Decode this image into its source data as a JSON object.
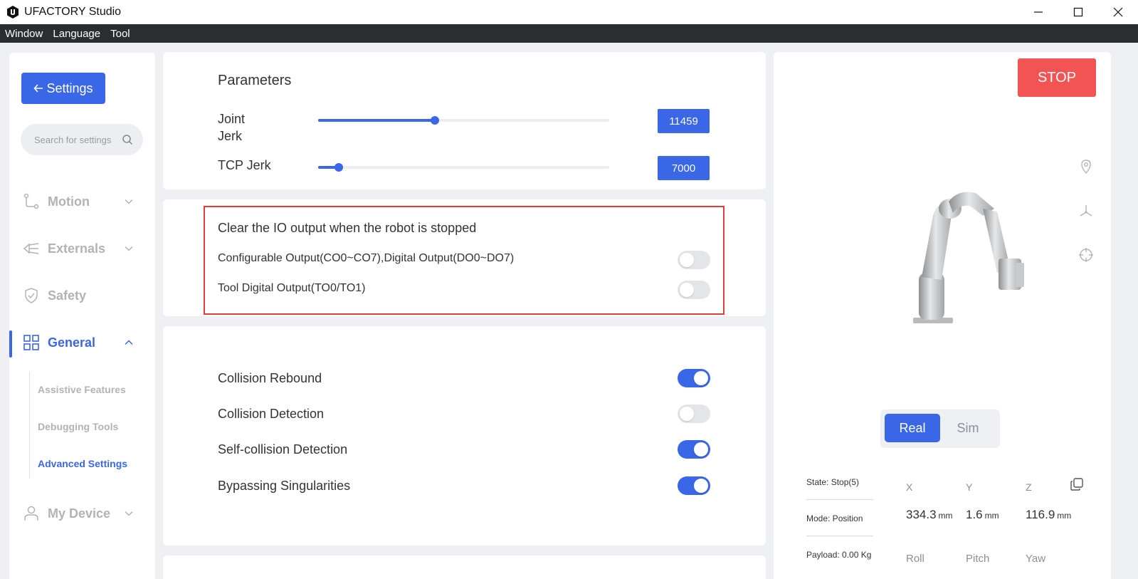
{
  "window": {
    "title": "UFACTORY Studio",
    "minimize_icon": "minimize-icon",
    "maximize_icon": "maximize-icon",
    "close_icon": "close-icon"
  },
  "menu": [
    "Window",
    "Language",
    "Tool"
  ],
  "sidebar": {
    "back_label": "Settings",
    "search_placeholder": "Search for settings",
    "items": [
      {
        "label": "Motion",
        "icon": "motion-icon",
        "expanded": false
      },
      {
        "label": "Externals",
        "icon": "externals-icon",
        "expanded": false
      },
      {
        "label": "Safety",
        "icon": "shield-icon"
      },
      {
        "label": "General",
        "icon": "grid-icon",
        "expanded": true,
        "active": true
      },
      {
        "label": "My Device",
        "icon": "user-icon",
        "expanded": false
      }
    ],
    "subitems": [
      "Assistive Features",
      "Debugging Tools",
      "Advanced Settings"
    ],
    "active_subitem": "Advanced Settings"
  },
  "parameters": {
    "title": "Parameters",
    "joint_jerk_line1": "Joint",
    "joint_jerk_line2": "Jerk",
    "joint_jerk_value": "11459",
    "joint_jerk_fraction": 0.4,
    "tcp_jerk_label": "TCP Jerk",
    "tcp_jerk_value": "7000",
    "tcp_jerk_fraction": 0.07
  },
  "io": {
    "title": "Clear the IO output when the robot is stopped",
    "configurable_label": "Configurable Output(CO0~CO7),Digital Output(DO0~DO7)",
    "configurable_on": false,
    "tool_label": "Tool Digital Output(TO0/TO1)",
    "tool_on": false
  },
  "features": {
    "collision_rebound": "Collision Rebound",
    "collision_rebound_on": true,
    "collision_detection": "Collision Detection",
    "collision_detection_on": false,
    "self_collision": "Self-collision Detection",
    "self_collision_on": true,
    "bypass_singularities": "Bypassing Singularities",
    "bypass_singularities_on": true
  },
  "right": {
    "stop_label": "STOP",
    "mode_real": "Real",
    "mode_sim": "Sim",
    "state": "State:  Stop(5)",
    "mode": "Mode:  Position",
    "payload": "Payload:  0.00 Kg",
    "x_label": "X",
    "y_label": "Y",
    "z_label": "Z",
    "x_value": "334.3",
    "y_value": "1.6",
    "z_value": "116.9",
    "unit": "mm",
    "roll_label": "Roll",
    "pitch_label": "Pitch",
    "yaw_label": "Yaw"
  },
  "colors": {
    "accent": "#3a66e8",
    "stop": "#f25454",
    "highlight": "#e53a3a"
  }
}
